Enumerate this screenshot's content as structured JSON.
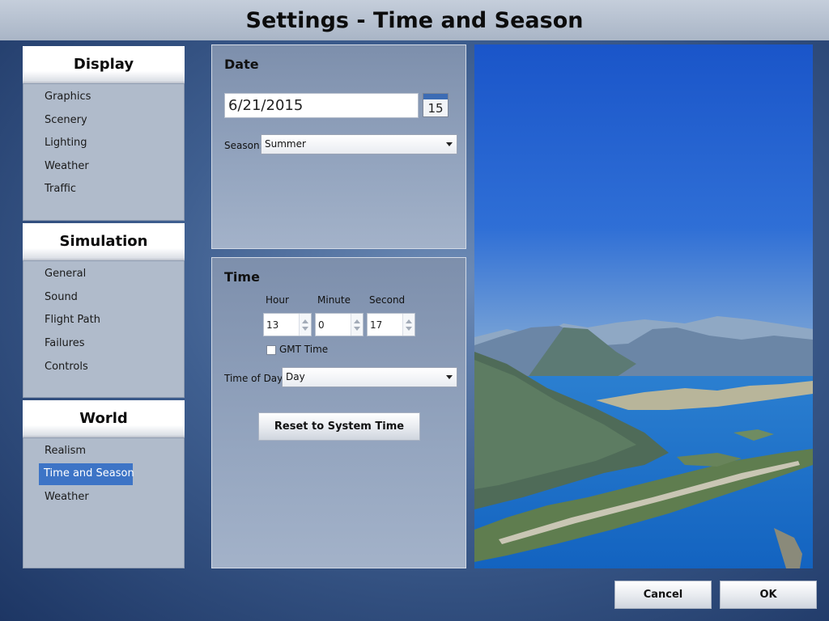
{
  "window": {
    "title": "Settings - Time and Season"
  },
  "sidebar": {
    "sections": [
      {
        "header": "Display",
        "items": [
          "Graphics",
          "Scenery",
          "Lighting",
          "Weather",
          "Traffic"
        ]
      },
      {
        "header": "Simulation",
        "items": [
          "General",
          "Sound",
          "Flight Path",
          "Failures",
          "Controls"
        ]
      },
      {
        "header": "World",
        "items": [
          "Realism",
          "Time and Season",
          "Weather"
        ],
        "selected": "Time and Season"
      }
    ]
  },
  "date_panel": {
    "title": "Date",
    "date_value": "6/21/2015",
    "calendar_icon_day": "15",
    "season_label": "Season:",
    "season_value": "Summer"
  },
  "time_panel": {
    "title": "Time",
    "hour_label": "Hour",
    "minute_label": "Minute",
    "second_label": "Second",
    "hour_value": "13",
    "minute_value": "0",
    "second_value": "17",
    "gmt_label": "GMT Time",
    "gmt_checked": false,
    "time_of_day_label": "Time of Day:",
    "time_of_day_value": "Day",
    "reset_button": "Reset to System Time"
  },
  "footer": {
    "cancel_label": "Cancel",
    "ok_label": "OK"
  },
  "colors": {
    "selection": "#3d74c6",
    "panel": "#8c9db8",
    "background": "#3f5f90"
  }
}
